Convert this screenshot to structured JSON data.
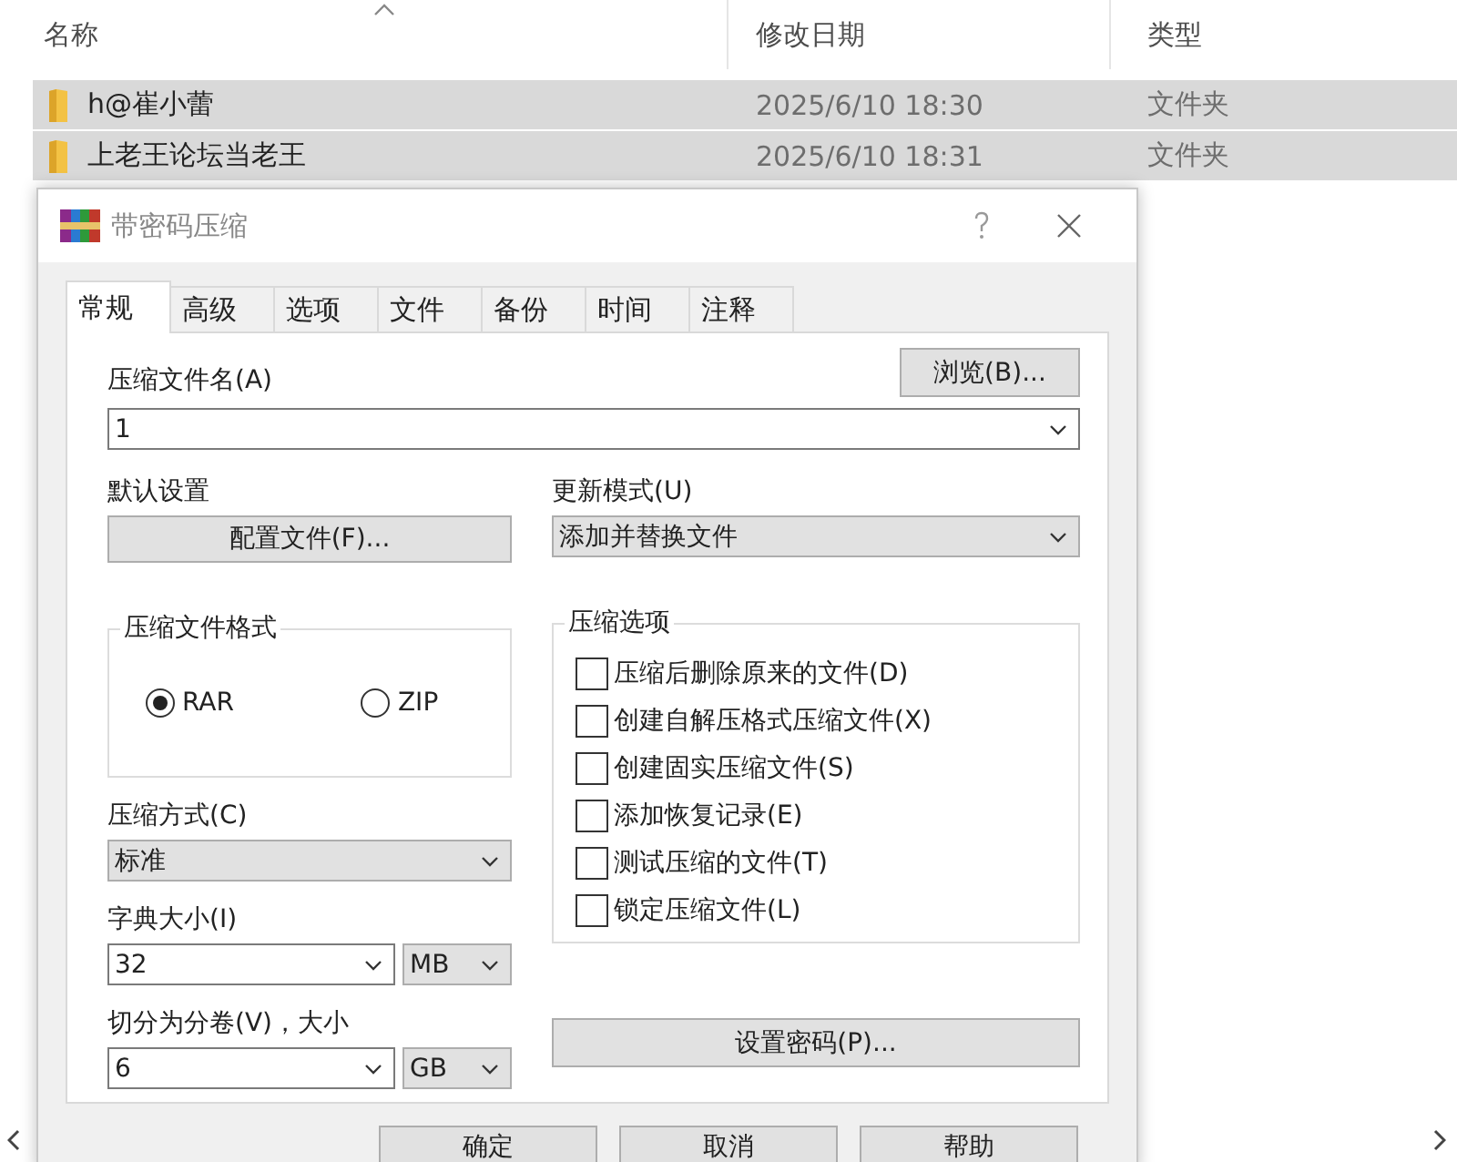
{
  "explorer": {
    "columns": [
      {
        "label": "名称",
        "sorted": true
      },
      {
        "label": "修改日期",
        "sorted": false
      },
      {
        "label": "类型",
        "sorted": false
      }
    ],
    "rows": [
      {
        "name": "h@崔小蕾",
        "date": "2025/6/10 18:30",
        "type": "文件夹",
        "selected": true
      },
      {
        "name": "上老王论坛当老王",
        "date": "2025/6/10 18:31",
        "type": "文件夹",
        "selected": true
      }
    ]
  },
  "dialog": {
    "title": "带密码压缩",
    "tabs": [
      {
        "label": "常规",
        "selected": true
      },
      {
        "label": "高级",
        "selected": false
      },
      {
        "label": "选项",
        "selected": false
      },
      {
        "label": "文件",
        "selected": false
      },
      {
        "label": "备份",
        "selected": false
      },
      {
        "label": "时间",
        "selected": false
      },
      {
        "label": "注释",
        "selected": false
      }
    ],
    "archive_name": {
      "label": "压缩文件名(A)",
      "value": "1",
      "kind": "editable"
    },
    "browse_button": "浏览(B)...",
    "default_settings": {
      "label": "默认设置",
      "button": "配置文件(F)..."
    },
    "update_mode": {
      "label": "更新模式(U)",
      "value": "添加并替换文件",
      "kind": "dropdown"
    },
    "format": {
      "label": "压缩文件格式",
      "options": [
        {
          "label": "RAR",
          "selected": true
        },
        {
          "label": "ZIP",
          "selected": false
        }
      ]
    },
    "options": {
      "label": "压缩选项",
      "items": [
        {
          "label": "压缩后删除原来的文件(D)",
          "checked": false
        },
        {
          "label": "创建自解压格式压缩文件(X)",
          "checked": false
        },
        {
          "label": "创建固实压缩文件(S)",
          "checked": false
        },
        {
          "label": "添加恢复记录(E)",
          "checked": false
        },
        {
          "label": "测试压缩的文件(T)",
          "checked": false
        },
        {
          "label": "锁定压缩文件(L)",
          "checked": false
        }
      ]
    },
    "method": {
      "label": "压缩方式(C)",
      "value": "标准",
      "kind": "dropdown"
    },
    "dictionary": {
      "label": "字典大小(I)",
      "value": "32",
      "kind": "editable",
      "unit": {
        "value": "MB",
        "kind": "dropdown"
      }
    },
    "volume": {
      "label": "切分为分卷(V)，大小",
      "value": "6",
      "kind": "editable",
      "unit": {
        "value": "GB",
        "kind": "dropdown"
      }
    },
    "password_button": "设置密码(P)...",
    "buttons": [
      "确定",
      "取消",
      "帮助"
    ]
  }
}
